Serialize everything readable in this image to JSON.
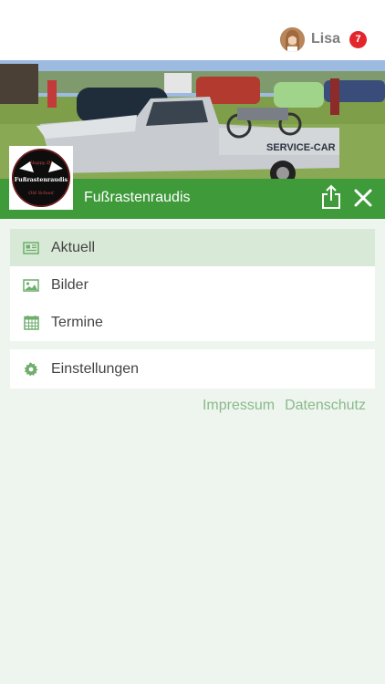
{
  "header": {
    "user_name": "Lisa",
    "notification_count": "7"
  },
  "group": {
    "title": "Fußrastenraudis",
    "logo_text_top": "Happy DJ",
    "logo_text_main": "Fußrastenraudis",
    "logo_text_bottom": "Old School",
    "hero_sign": "SERVICE-CAR"
  },
  "menu": {
    "items": [
      {
        "label": "Aktuell",
        "icon": "newspaper-icon",
        "active": true
      },
      {
        "label": "Bilder",
        "icon": "image-icon",
        "active": false
      },
      {
        "label": "Termine",
        "icon": "calendar-icon",
        "active": false
      }
    ],
    "settings": {
      "label": "Einstellungen",
      "icon": "gear-icon"
    }
  },
  "footer": {
    "impressum": "Impressum",
    "datenschutz": "Datenschutz"
  },
  "colors": {
    "brand_green": "#3f9a3a",
    "active_bg": "#d8ead7",
    "link_green": "#8ab98a",
    "badge_red": "#e2262c"
  }
}
